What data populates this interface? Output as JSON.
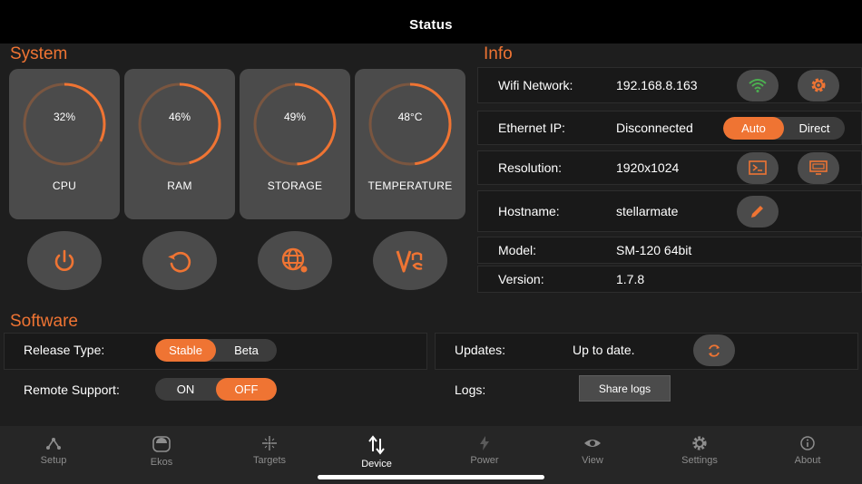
{
  "header": {
    "title": "Status"
  },
  "system": {
    "title": "System",
    "gauges": [
      {
        "label": "CPU",
        "value_text": "32%",
        "fraction": 0.32
      },
      {
        "label": "RAM",
        "value_text": "46%",
        "fraction": 0.46
      },
      {
        "label": "STORAGE",
        "value_text": "49%",
        "fraction": 0.49
      },
      {
        "label": "TEMPERATURE",
        "value_text": "48°C",
        "fraction": 0.48
      }
    ],
    "actions": [
      "power-icon",
      "restart-icon",
      "globe-icon",
      "vnc-icon"
    ]
  },
  "info": {
    "title": "Info",
    "wifi": {
      "label": "Wifi Network:",
      "value": "192.168.8.163"
    },
    "ethernet": {
      "label": "Ethernet IP:",
      "value": "Disconnected",
      "options": [
        "Auto",
        "Direct"
      ],
      "selected": "Auto"
    },
    "resolution": {
      "label": "Resolution:",
      "value": "1920x1024"
    },
    "hostname": {
      "label": "Hostname:",
      "value": "stellarmate"
    },
    "model": {
      "label": "Model:",
      "value": "SM-120 64bit"
    },
    "version": {
      "label": "Version:",
      "value": "1.7.8"
    }
  },
  "software": {
    "title": "Software",
    "release_type": {
      "label": "Release Type:",
      "options": [
        "Stable",
        "Beta"
      ],
      "selected": "Stable"
    },
    "remote_support": {
      "label": "Remote Support:",
      "options": [
        "ON",
        "OFF"
      ],
      "selected": "OFF"
    },
    "updates": {
      "label": "Updates:",
      "value": "Up to date."
    },
    "logs": {
      "label": "Logs:",
      "button": "Share logs"
    }
  },
  "tabs": [
    {
      "label": "Setup",
      "icon": "setup-icon",
      "active": false
    },
    {
      "label": "Ekos",
      "icon": "ekos-icon",
      "active": false
    },
    {
      "label": "Targets",
      "icon": "targets-icon",
      "active": false
    },
    {
      "label": "Device",
      "icon": "device-icon",
      "active": true
    },
    {
      "label": "Power",
      "icon": "power-bolt-icon",
      "active": false
    },
    {
      "label": "View",
      "icon": "eye-icon",
      "active": false
    },
    {
      "label": "Settings",
      "icon": "gear-icon",
      "active": false
    },
    {
      "label": "About",
      "icon": "info-icon",
      "active": false
    }
  ],
  "colors": {
    "accent": "#ef7433",
    "card": "#4b4b4b",
    "panel": "#191919",
    "background": "#1e1e1e"
  }
}
